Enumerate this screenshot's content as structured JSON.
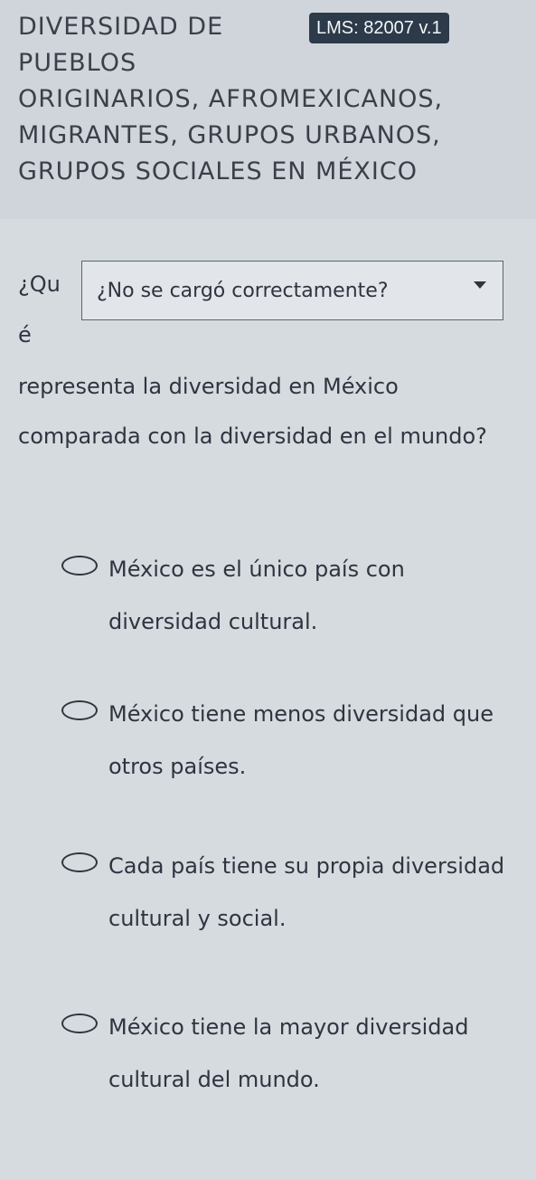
{
  "header": {
    "title": "DIVERSIDAD DE\nPUEBLOS\nORIGINARIOS, AFROMEXICANOS,\nMIGRANTES, GRUPOS URBANOS,\nGRUPOS SOCIALES EN MÉXICO",
    "lms_badge": "LMS: 82007 v.1"
  },
  "question": {
    "part1": "¿Qu",
    "part2": "é",
    "rest": "representa la diversidad en México comparada con la diversidad en el mundo?"
  },
  "load_dropdown": {
    "label": "¿No se cargó correctamente?"
  },
  "options": [
    {
      "text": "México es el único país con diversidad cultural.",
      "selected": false
    },
    {
      "text": "México tiene menos diversidad que otros países.",
      "selected": false
    },
    {
      "text": "Cada país tiene su propia diversidad cultural y social.",
      "selected": false
    },
    {
      "text": "México tiene la mayor diversidad cultural del mundo.",
      "selected": false
    }
  ],
  "icons": {
    "caret": "chevron-down-icon",
    "radio": "radio-circle-icon"
  }
}
